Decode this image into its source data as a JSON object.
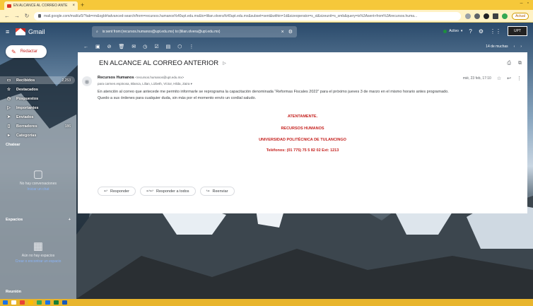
{
  "browser": {
    "tab_title": "EN ALCANCE AL CORREO ANTE",
    "tab_close": "×",
    "new_tab": "+",
    "url": "mail.google.com/mail/u/0/?tab=rm&ogbl#advanced-search/from=recursos.humanos%40upt.edu.mx&to=lilian.olvera%40upt.edu.mx&subset=sent&within=1d&sizeoperator=s_sl&sizeunit=s_smb&query=is%3Asent+from%3Arecursos.huma...",
    "update_label": "Actual"
  },
  "gmail": {
    "app_name": "Gmail",
    "search_query": "is:sent from:(recursos.humanos@upt.edu.mx) to:(lilian.olvera@upt.edu.mx)",
    "status": "Activo",
    "account_label": "UPT"
  },
  "sidebar": {
    "compose": "Redactar",
    "items": [
      {
        "label": "Recibidos",
        "count": "2,253",
        "icon": "inbox-icon"
      },
      {
        "label": "Destacados",
        "count": "",
        "icon": "star-icon"
      },
      {
        "label": "Pospuestos",
        "count": "",
        "icon": "clock-icon"
      },
      {
        "label": "Importantes",
        "count": "",
        "icon": "label-important-icon"
      },
      {
        "label": "Enviados",
        "count": "",
        "icon": "send-icon"
      },
      {
        "label": "Borradores",
        "count": "186",
        "icon": "draft-icon"
      },
      {
        "label": "Categorías",
        "count": "",
        "icon": "category-icon"
      }
    ],
    "chat_header": "Chatear",
    "chat_empty_line1": "No hay conversaciones",
    "chat_empty_line2": "Iniciar un chat",
    "spaces_header": "Espacios",
    "spaces_add": "+",
    "spaces_empty_line1": "Aún no hay espacios",
    "spaces_empty_line2": "Crear o encontrar un espacio",
    "meet_header": "Reunión"
  },
  "toolbar": {
    "pager": "14 de muchas"
  },
  "email": {
    "subject": "EN ALCANCE AL CORREO ANTERIOR",
    "sender_name": "Recursos Humanos",
    "sender_email": "<recursos.humanos@upt.edu.mx>",
    "to_line": "para carmen.espinosa, Blanca, Lilian, Lizbeth, Víctor, Hilda, Zaira ▾",
    "date": "mié, 23 feb, 17:10",
    "body_line1": "En atención al correo que antecede me permito informarle se reprograma la capacitación denominada “Reformas Fiscales 2022” para el próximo jueves 3 de marzo en el mismo horario antes programado.",
    "body_line2": "Quedo a sus órdenes para cualquier duda, sin más por el momento envío un cordial saludo.",
    "sig_1": "ATENTAMENTE.",
    "sig_2": "RECURSOS HUMANOS",
    "sig_3": "UNIVERSIDAD POLITÉCNICA DE TULANCINGO",
    "sig_4": "Teléfonos: (01 775) 75 5 82 02 Ext: 1213"
  },
  "actions": {
    "reply": "Responder",
    "reply_all": "Responder a todos",
    "forward": "Reenviar"
  }
}
